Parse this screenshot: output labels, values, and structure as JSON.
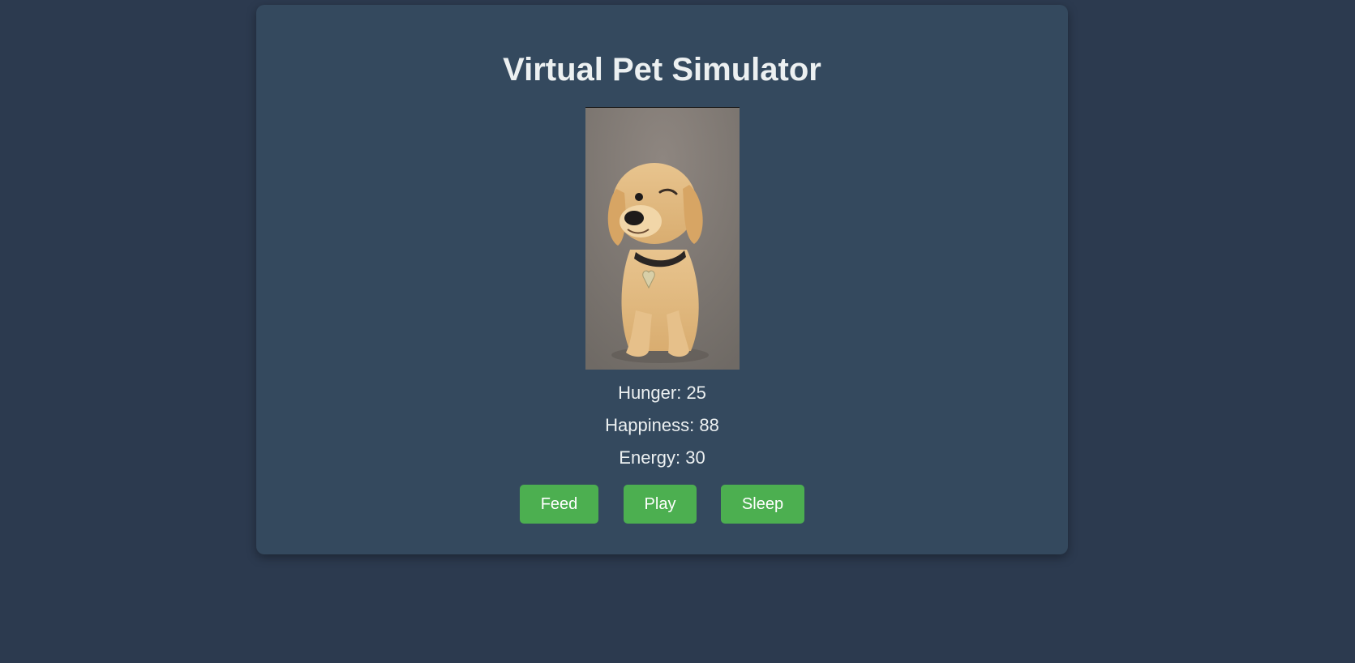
{
  "app": {
    "title": "Virtual Pet Simulator"
  },
  "pet": {
    "image_icon": "puppy-photo"
  },
  "stats": {
    "hunger": "Hunger: 25",
    "happiness": "Happiness: 88",
    "energy": "Energy: 30"
  },
  "actions": {
    "feed_label": "Feed",
    "play_label": "Play",
    "sleep_label": "Sleep"
  },
  "colors": {
    "background": "#2c3a4f",
    "card": "#34495e",
    "button": "#4caf50",
    "text": "#ecf0f1"
  }
}
